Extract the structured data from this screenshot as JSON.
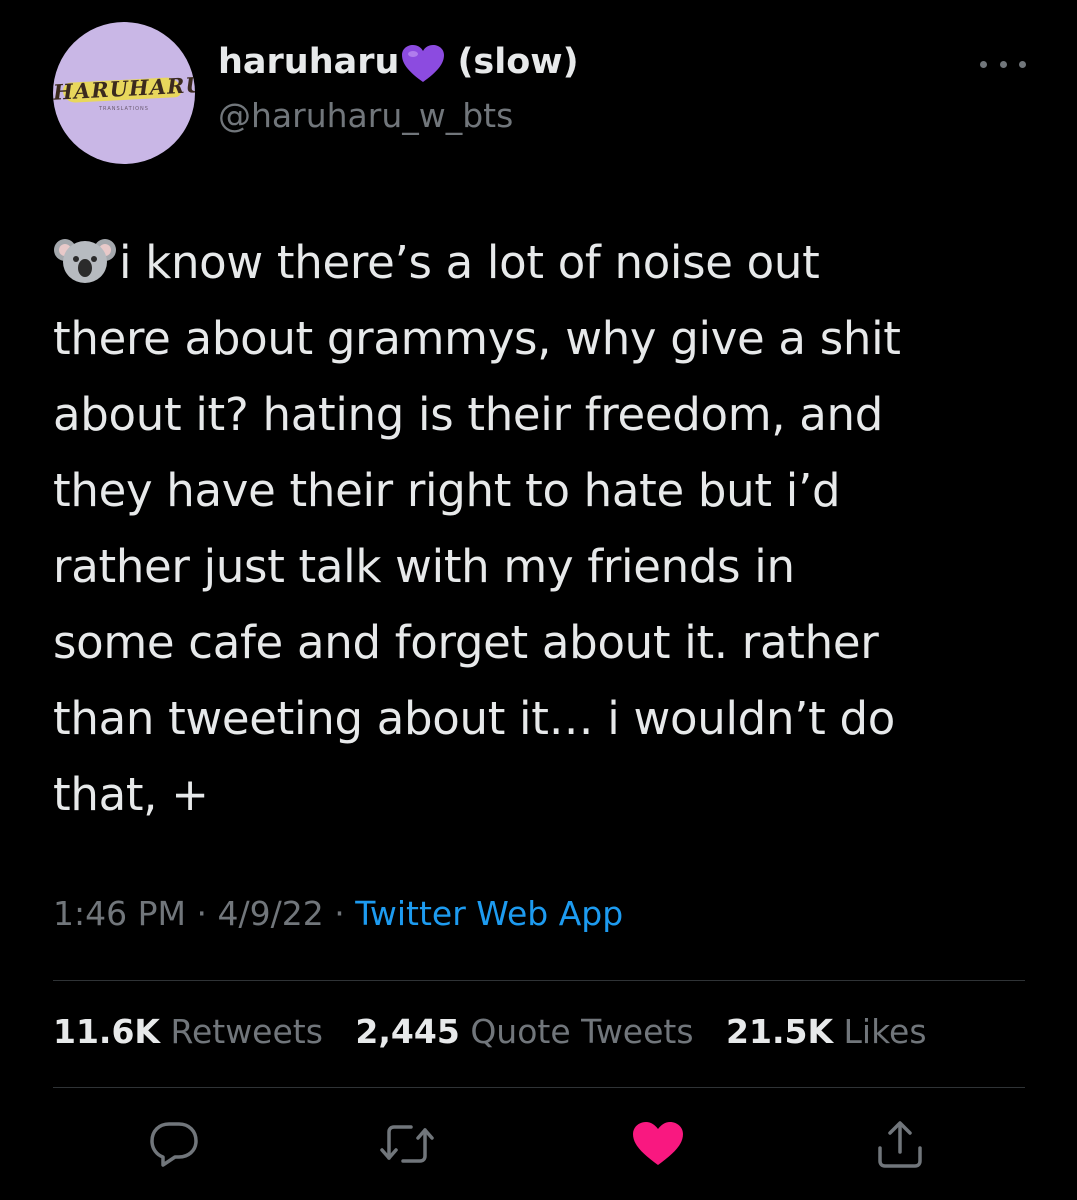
{
  "author": {
    "display_name": "haruharu",
    "name_suffix": "(slow)",
    "handle": "@haruharu_w_bts",
    "avatar_text": "HARUHARU",
    "avatar_subtext": "TRANSLATIONS"
  },
  "tweet": {
    "lines": [
      "i know there’s a lot of noise out",
      "there about grammys, why give a shit",
      "about it? hating is their freedom, and",
      "they have their right to hate but i’d",
      "rather just talk with my friends in",
      "some cafe and forget about it. rather",
      "than tweeting about it… i wouldn’t do",
      "that, +"
    ],
    "leading_emoji": "koala-icon"
  },
  "meta": {
    "time": "1:46 PM",
    "separator": "·",
    "date": "4/9/22",
    "source": "Twitter Web App"
  },
  "stats": {
    "retweets_count": "11.6K",
    "retweets_label": "Retweets",
    "quotes_count": "2,445",
    "quotes_label": "Quote Tweets",
    "likes_count": "21.5K",
    "likes_label": "Likes"
  },
  "actions": {
    "reply_icon": "reply-icon",
    "retweet_icon": "retweet-icon",
    "like_icon": "heart-icon",
    "share_icon": "share-icon",
    "liked": true
  },
  "colors": {
    "background": "#000000",
    "text": "#e7e9ea",
    "secondary": "#71767b",
    "link": "#1d9bf0",
    "like": "#f91880",
    "badge_heart": "#8c4be0"
  }
}
